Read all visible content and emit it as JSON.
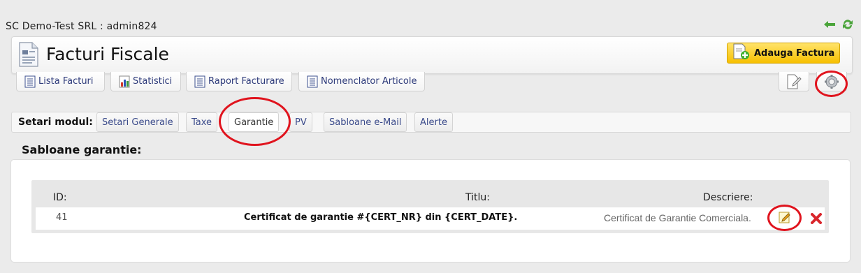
{
  "company_line": "SC Demo-Test SRL : admin824",
  "header": {
    "title": "Facturi Fiscale",
    "add_button_label": "Adauga Factura"
  },
  "tabs": [
    {
      "label": "Lista Facturi",
      "icon": "list-doc-icon"
    },
    {
      "label": "Statistici",
      "icon": "bar-chart-icon"
    },
    {
      "label": "Raport Facturare",
      "icon": "list-doc-icon"
    },
    {
      "label": "Nomenclator Articole",
      "icon": "list-doc-icon"
    }
  ],
  "settings": {
    "label": "Setari modul:",
    "tabs": [
      "Setari Generale",
      "Taxe",
      "Garantie",
      "PV",
      "Sabloane e-Mail",
      "Alerte"
    ],
    "active_tab": "Garantie"
  },
  "section_title": "Sabloane garantie:",
  "table": {
    "headers": {
      "id": "ID:",
      "titlu": "Titlu:",
      "descriere": "Descriere:"
    },
    "rows": [
      {
        "id": "41",
        "titlu": "Certificat de garantie #{CERT_NR} din {CERT_DATE}.",
        "descriere": "Certificat de Garantie Comerciala."
      }
    ]
  },
  "colors": {
    "accent_yellow": "#f7c000",
    "link_blue": "#2d3a7a",
    "annotation_red": "#e0141e",
    "delete_red": "#d9262c"
  }
}
